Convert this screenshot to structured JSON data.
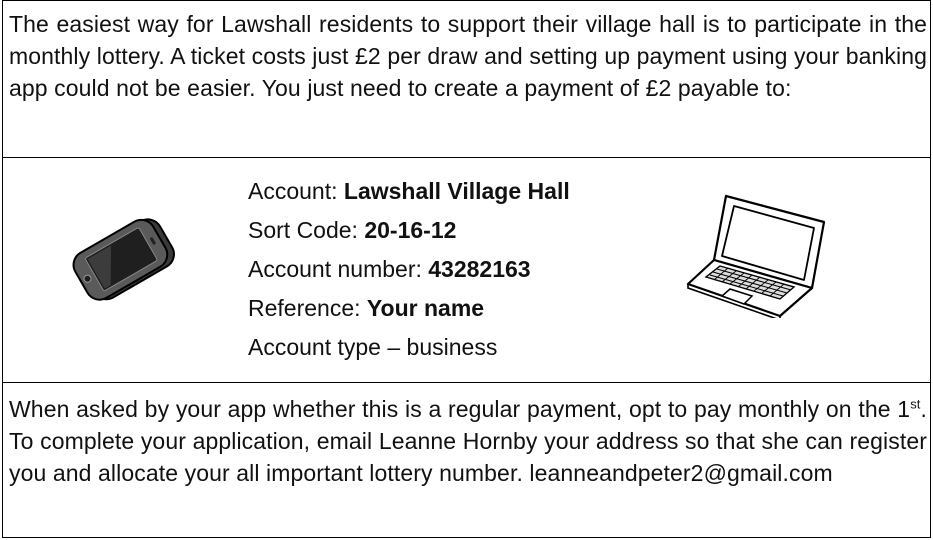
{
  "intro": {
    "text": "The easiest way for Lawshall residents to support their village hall is to participate in the monthly lottery.  A ticket costs just £2 per draw and setting up payment using your banking app could not be easier.  You just need to create a payment of £2 payable to:"
  },
  "details": {
    "account_label": "Account: ",
    "account_value": "Lawshall Village Hall",
    "sort_code_label": "Sort Code: ",
    "sort_code_value": "20-16-12",
    "account_number_label": "Account number: ",
    "account_number_value": "43282163",
    "reference_label": "Reference:  ",
    "reference_value": "Your name",
    "account_type": "Account type – business"
  },
  "icons": {
    "left": "mobile-phone-icon",
    "right": "laptop-icon"
  },
  "outro": {
    "part1": "When asked by your app whether this is a regular payment, opt to pay monthly on the 1",
    "ordinal": "st",
    "part2": ".  To complete your application, email  Leanne Hornby your address so that she can register you and allocate your all important lottery number.    ",
    "email": "leanneandpeter2@gmail.com"
  }
}
